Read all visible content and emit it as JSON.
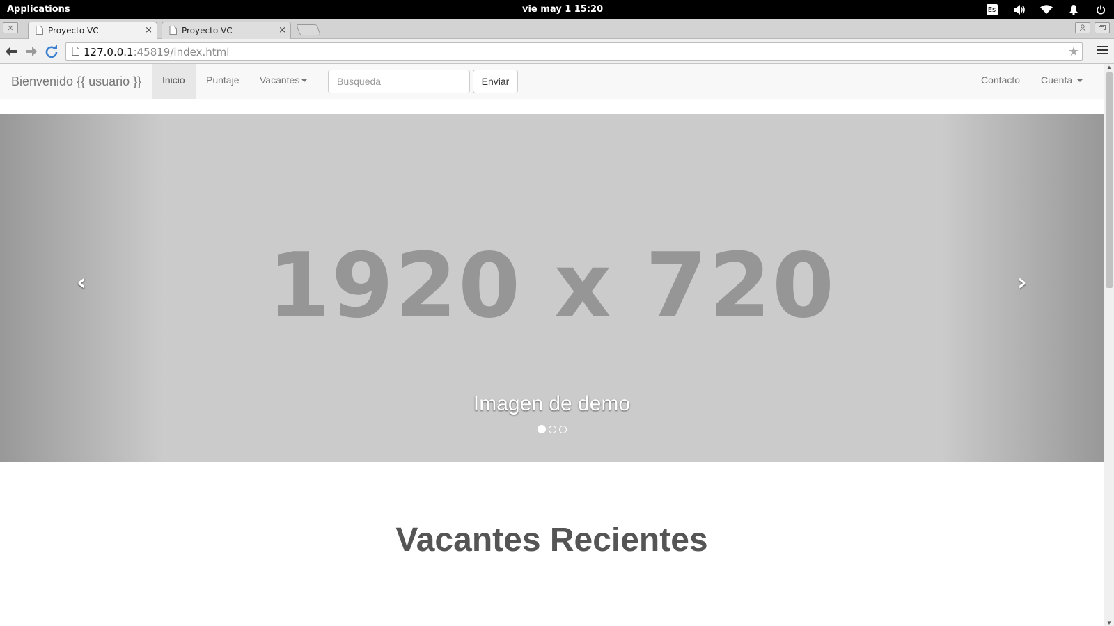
{
  "system_bar": {
    "apps_label": "Applications",
    "clock": "vie may 1   15:20",
    "keyboard_layout": "Es"
  },
  "browser": {
    "tabs": [
      {
        "title": "Proyecto VC",
        "active": true
      },
      {
        "title": "Proyecto VC",
        "active": false
      }
    ],
    "url_host": "127.0.0.1",
    "url_rest": ":45819/index.html"
  },
  "navbar": {
    "brand": "Bienvenido {{ usuario }}",
    "items": [
      {
        "label": "Inicio",
        "active": true
      },
      {
        "label": "Puntaje"
      },
      {
        "label": "Vacantes",
        "dropdown": true
      }
    ],
    "search_placeholder": "Busqueda",
    "submit_label": "Enviar",
    "right_items": [
      {
        "label": "Contacto"
      },
      {
        "label": "Cuenta",
        "dropdown": true
      }
    ]
  },
  "carousel": {
    "placeholder_text": "1920 x 720",
    "caption": "Imagen de demo",
    "prev_icon": "‹",
    "next_icon": "›",
    "slide_count": 3,
    "active_slide": 1,
    "background_color": "#cbcbcb"
  },
  "content": {
    "section_title": "Vacantes Recientes"
  }
}
